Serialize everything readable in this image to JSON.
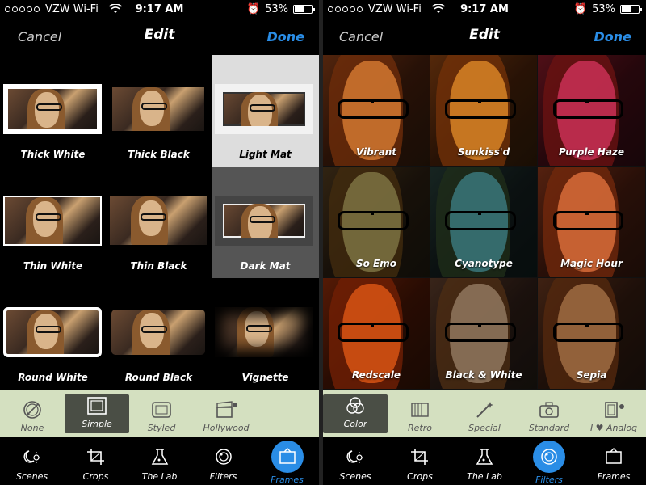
{
  "status": {
    "carrier": "VZW Wi-Fi",
    "time": "9:17 AM",
    "battery": "53%",
    "battery_level": 0.53
  },
  "left": {
    "nav": {
      "cancel": "Cancel",
      "title": "Edit",
      "done": "Done"
    },
    "frames": [
      {
        "label": "Thick White",
        "style": "thickwhite",
        "selected": false
      },
      {
        "label": "Thick Black",
        "style": "thickblack",
        "selected": false
      },
      {
        "label": "Light Mat",
        "style": "lightmat",
        "selected": true
      },
      {
        "label": "Thin White",
        "style": "thinwhite",
        "selected": false
      },
      {
        "label": "Thin Black",
        "style": "thinblack",
        "selected": false
      },
      {
        "label": "Dark Mat",
        "style": "darkmat",
        "selected": true
      },
      {
        "label": "Round White",
        "style": "roundwhite",
        "selected": false
      },
      {
        "label": "Round Black",
        "style": "roundblack",
        "selected": false
      },
      {
        "label": "Vignette",
        "style": "vignette",
        "selected": false
      }
    ],
    "toolbar": [
      {
        "label": "None",
        "icon": "none-icon",
        "selected": false
      },
      {
        "label": "Simple",
        "icon": "simple-frame-icon",
        "selected": true
      },
      {
        "label": "Styled",
        "icon": "styled-frame-icon",
        "selected": false
      },
      {
        "label": "Hollywood",
        "icon": "clapperboard-icon",
        "selected": false
      }
    ],
    "tabs": [
      {
        "label": "Scenes",
        "icon": "scenes-icon",
        "active": false
      },
      {
        "label": "Crops",
        "icon": "crop-icon",
        "active": false
      },
      {
        "label": "The Lab",
        "icon": "flask-icon",
        "active": false
      },
      {
        "label": "Filters",
        "icon": "filters-icon",
        "active": false
      },
      {
        "label": "Frames",
        "icon": "frame-icon",
        "active": true
      }
    ]
  },
  "right": {
    "nav": {
      "cancel": "Cancel",
      "title": "Edit",
      "done": "Done"
    },
    "filters": [
      {
        "label": "Vibrant",
        "tint": "#e8a050"
      },
      {
        "label": "Sunkiss'd",
        "tint": "#f0b040"
      },
      {
        "label": "Purple Haze",
        "tint": "#e04090"
      },
      {
        "label": "So Emo",
        "tint": "#8a9a70"
      },
      {
        "label": "Cyanotype",
        "tint": "#40a0d0"
      },
      {
        "label": "Magic Hour",
        "tint": "#f09060"
      },
      {
        "label": "Redscale",
        "tint": "#f07020"
      },
      {
        "label": "Black & White",
        "tint": "#a0a0a0"
      },
      {
        "label": "Sepia",
        "tint": "#b09070"
      }
    ],
    "toolbar": [
      {
        "label": "Color",
        "icon": "color-circles-icon",
        "selected": true
      },
      {
        "label": "Retro",
        "icon": "retro-icon",
        "selected": false
      },
      {
        "label": "Special",
        "icon": "magic-wand-icon",
        "selected": false
      },
      {
        "label": "Standard",
        "icon": "camera-icon",
        "selected": false
      },
      {
        "label": "I ♥ Analog",
        "icon": "film-icon",
        "selected": false
      }
    ],
    "tabs": [
      {
        "label": "Scenes",
        "icon": "scenes-icon",
        "active": false
      },
      {
        "label": "Crops",
        "icon": "crop-icon",
        "active": false
      },
      {
        "label": "The Lab",
        "icon": "flask-icon",
        "active": false
      },
      {
        "label": "Filters",
        "icon": "filters-icon",
        "active": true
      },
      {
        "label": "Frames",
        "icon": "frame-icon",
        "active": false
      }
    ]
  }
}
